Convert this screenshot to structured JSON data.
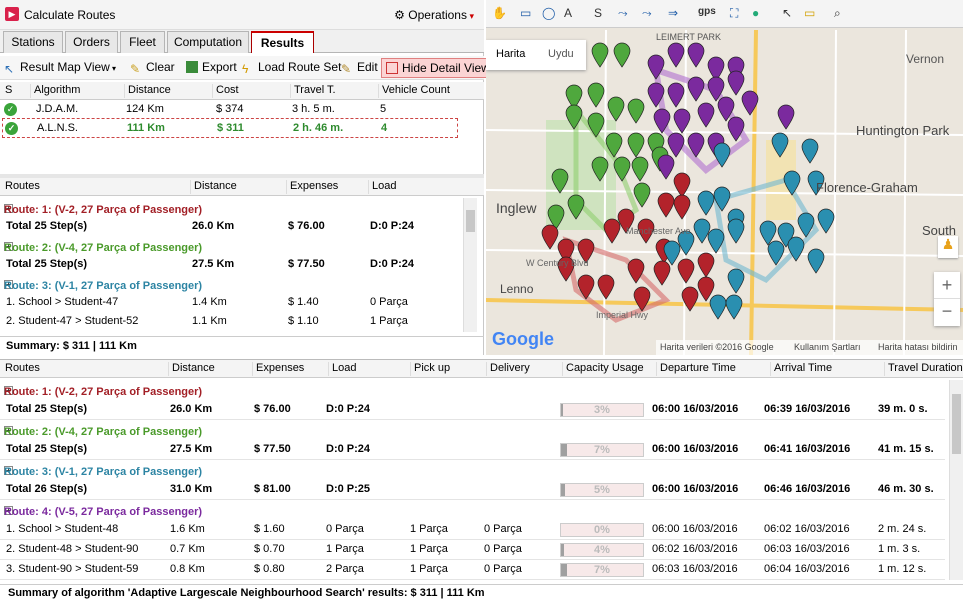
{
  "app": {
    "title": "Calculate Routes",
    "operations": "Operations"
  },
  "tabs": [
    "Stations",
    "Orders",
    "Fleet",
    "Computation",
    "Results"
  ],
  "toolbar": {
    "result_map_view": "Result Map View",
    "clear": "Clear",
    "export": "Export",
    "load_route_set": "Load Route Set",
    "edit": "Edit",
    "hide_detail_view": "Hide Detail View"
  },
  "algorithms": {
    "headers": [
      "S",
      "Algorithm",
      "Distance",
      "Cost",
      "Travel T.",
      "Vehicle Count"
    ],
    "rows": [
      {
        "name": "J.D.A.M.",
        "distance": "124 Km",
        "cost": "$ 374",
        "travel": "3 h. 5 m.",
        "vehicles": "5"
      },
      {
        "name": "A.L.N.S.",
        "distance": "111 Km",
        "cost": "$ 311",
        "travel": "2 h. 46 m.",
        "vehicles": "4"
      }
    ]
  },
  "routes_panel": {
    "headers": [
      "Routes",
      "Distance",
      "Expenses",
      "Load"
    ],
    "route1": {
      "title": "Route: 1: (V-2, 27 Parça of  Passenger)",
      "total": "Total 25 Step(s)",
      "distance": "26.0 Km",
      "expenses": "$ 76.00",
      "load": "D:0 P:24"
    },
    "route2": {
      "title": "Route: 2: (V-4, 27 Parça of  Passenger)",
      "total": "Total 25 Step(s)",
      "distance": "27.5 Km",
      "expenses": "$ 77.50",
      "load": "D:0 P:24"
    },
    "route3": {
      "title": "Route: 3: (V-1, 27 Parça of  Passenger)"
    },
    "steps": [
      {
        "name": "1. School > Student-47",
        "distance": "1.4 Km",
        "expenses": "$ 1.40",
        "load": "0 Parça"
      },
      {
        "name": "2. Student-47 > Student-52",
        "distance": "1.1 Km",
        "expenses": "$ 1.10",
        "load": "1 Parça"
      }
    ],
    "summary": "Summary: $ 311  |  111 Km"
  },
  "map": {
    "tabs": [
      "Harita",
      "Uydu"
    ],
    "labels": [
      "LEIMERT PARK",
      "Vernon",
      "Huntington Park",
      "Inglew",
      "Florence-Graham",
      "South",
      "Lenno",
      "W Century Blvd",
      "Imperial Hwy",
      "Manchester Ave"
    ],
    "toolbar_gps": "gps",
    "attribution": "Harita verileri ©2016 Google",
    "terms": "Kullanım Şartları",
    "report": "Harita hatası bildirin",
    "google": "Google",
    "zoom_in": "+",
    "zoom_out": "−",
    "colors": {
      "green": "#4fa83d",
      "purple": "#7b2a9e",
      "red": "#b3232b",
      "blue": "#2a8fb0"
    }
  },
  "details": {
    "headers": [
      "Routes",
      "Distance",
      "Expenses",
      "Load",
      "Pick up",
      "Delivery",
      "Capacity Usage",
      "Departure Time",
      "Arrival Time",
      "Travel Duration"
    ],
    "routes": [
      {
        "title": "Route: 1: (V-2, 27 Parça of  Passenger)",
        "total": "Total 25 Step(s)",
        "distance": "26.0 Km",
        "expenses": "$ 76.00",
        "load": "D:0 P:24",
        "usage": "3%",
        "usage_val": 3,
        "dep": "06:00 16/03/2016",
        "arr": "06:39 16/03/2016",
        "dur": "39 m. 0 s."
      },
      {
        "title": "Route: 2: (V-4, 27 Parça of  Passenger)",
        "total": "Total 25 Step(s)",
        "distance": "27.5 Km",
        "expenses": "$ 77.50",
        "load": "D:0 P:24",
        "usage": "7%",
        "usage_val": 7,
        "dep": "06:00 16/03/2016",
        "arr": "06:41 16/03/2016",
        "dur": "41 m. 15 s."
      },
      {
        "title": "Route: 3: (V-1, 27 Parça of  Passenger)",
        "total": "Total 26 Step(s)",
        "distance": "31.0 Km",
        "expenses": "$ 81.00",
        "load": "D:0 P:25",
        "usage": "5%",
        "usage_val": 5,
        "dep": "06:00 16/03/2016",
        "arr": "06:46 16/03/2016",
        "dur": "46 m. 30 s."
      },
      {
        "title": "Route: 4: (V-5, 27 Parça of  Passenger)"
      }
    ],
    "steps": [
      {
        "name": "1. School > Student-48",
        "distance": "1.6 Km",
        "expenses": "$ 1.60",
        "load": "0 Parça",
        "pick": "1 Parça",
        "deliv": "0 Parça",
        "usage": "0%",
        "usage_val": 0,
        "dep": "06:00 16/03/2016",
        "arr": "06:02 16/03/2016",
        "dur": "2 m. 24 s."
      },
      {
        "name": "2. Student-48 > Student-90",
        "distance": "0.7 Km",
        "expenses": "$ 0.70",
        "load": "1 Parça",
        "pick": "1 Parça",
        "deliv": "0 Parça",
        "usage": "4%",
        "usage_val": 4,
        "dep": "06:02 16/03/2016",
        "arr": "06:03 16/03/2016",
        "dur": "1 m. 3 s."
      },
      {
        "name": "3. Student-90 > Student-59",
        "distance": "0.8 Km",
        "expenses": "$ 0.80",
        "load": "2 Parça",
        "pick": "1 Parça",
        "deliv": "0 Parça",
        "usage": "7%",
        "usage_val": 7,
        "dep": "06:03 16/03/2016",
        "arr": "06:04 16/03/2016",
        "dur": "1 m. 12 s."
      }
    ],
    "summary": "Summary of algorithm 'Adaptive Largescale Neighbourhood Search' results: $ 311  |  111 Km"
  }
}
